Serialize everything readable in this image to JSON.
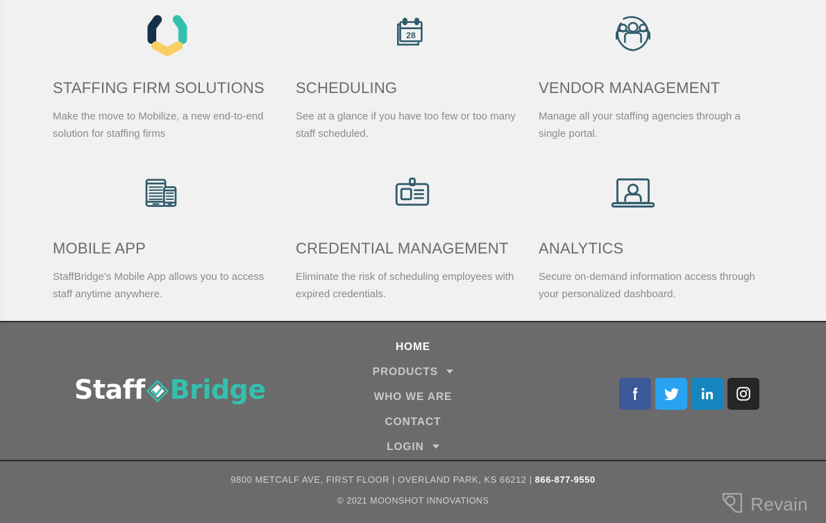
{
  "features": [
    {
      "icon": "staffbridge-circle-logo-icon",
      "title": "STAFFING FIRM SOLUTIONS",
      "description": "Make the move to Mobilize, a new end-to-end solution for staffing firms"
    },
    {
      "icon": "calendar-icon",
      "icon_label": "28",
      "title": "SCHEDULING",
      "description": "See at a glance if you have too few or too many staff scheduled."
    },
    {
      "icon": "people-group-circle-icon",
      "title": "VENDOR MANAGEMENT",
      "description": "Manage all your staffing agencies through a single portal."
    },
    {
      "icon": "tablet-and-phone-icon",
      "title": "MOBILE APP",
      "description": "StaffBridge's Mobile App allows you to access staff anytime anywhere."
    },
    {
      "icon": "id-badge-card-icon",
      "title": "CREDENTIAL MANAGEMENT",
      "description": "Eliminate the risk of scheduling employees with expired credentials."
    },
    {
      "icon": "laptop-person-icon",
      "title": "ANALYTICS",
      "description": "Secure on-demand information access through your personalized dashboard."
    }
  ],
  "footer": {
    "logo": {
      "first": "Staff",
      "second": "Bridge",
      "mark_icon": "staffbridge-diamond-mark-icon"
    },
    "nav": [
      {
        "label": "HOME",
        "active": true,
        "dropdown": false
      },
      {
        "label": "PRODUCTS",
        "active": false,
        "dropdown": true
      },
      {
        "label": "WHO WE ARE",
        "active": false,
        "dropdown": false
      },
      {
        "label": "CONTACT",
        "active": false,
        "dropdown": false
      },
      {
        "label": "LOGIN",
        "active": false,
        "dropdown": true
      }
    ],
    "socials": [
      {
        "name": "facebook-icon",
        "label": "Facebook",
        "color": "#3b5998"
      },
      {
        "name": "twitter-icon",
        "label": "Twitter",
        "color": "#29a3f1"
      },
      {
        "name": "linkedin-icon",
        "label": "LinkedIn",
        "color": "#1585bd"
      },
      {
        "name": "instagram-icon",
        "label": "Instagram",
        "color": "#262626"
      }
    ],
    "address_line1": "9800 METCALF AVE, FIRST FLOOR  |  OVERLAND PARK, KS 66212 | ",
    "phone": "866-877-9550",
    "copyright": "© 2021 MOONSHOT INNOVATIONS"
  },
  "watermark": {
    "text": "Revain",
    "icon": "revain-logo-icon"
  },
  "colors": {
    "page_background": "#f1f1f1",
    "footer_background": "#6b6b6b",
    "heading_text": "#6b6b6b",
    "body_text": "#8a8a8a",
    "icon_stroke": "#2f5a6b",
    "brand_teal": "#35bfae",
    "brand_navy": "#16304a",
    "brand_yellow": "#f8cf62"
  }
}
